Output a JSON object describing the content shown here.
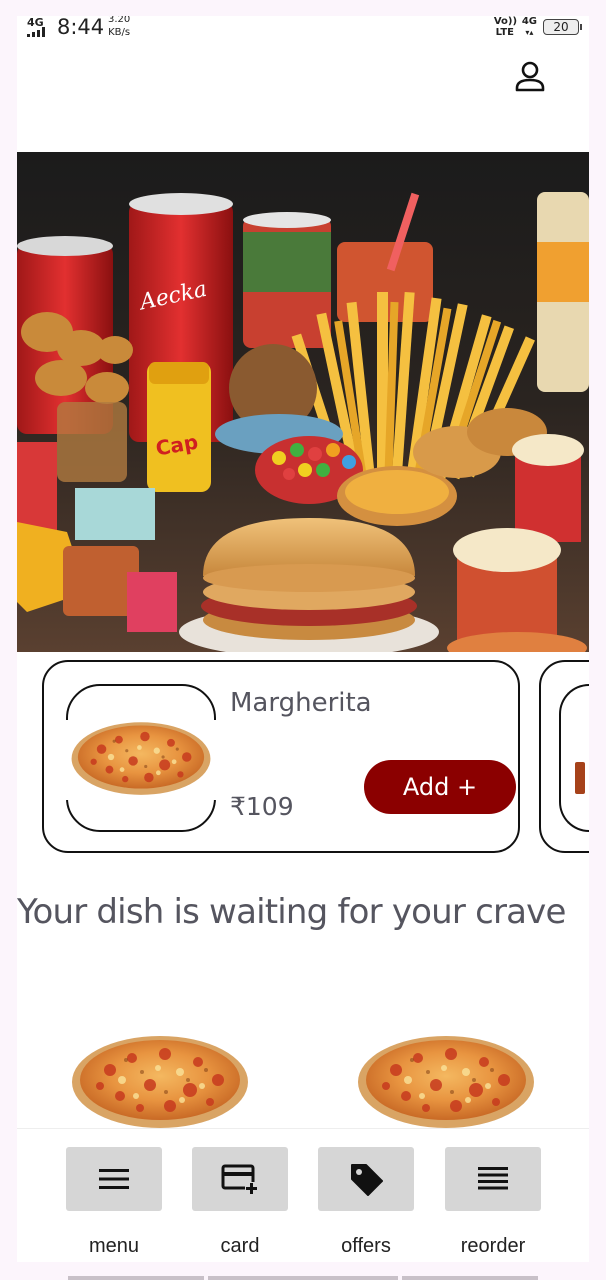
{
  "status_bar": {
    "network": "4G",
    "time": "8:44",
    "speed_value": "3.20",
    "speed_unit": "KB/s",
    "volte": "Vo)) LTE",
    "data_type": "4G",
    "battery": "20"
  },
  "header": {
    "profile_icon": "person-icon"
  },
  "hero": {
    "image": "fast-food-spread"
  },
  "featured": {
    "name": "Margherita",
    "price": "₹109",
    "add_label": "Add  +",
    "accent": "#8b0000"
  },
  "main": {
    "heading": "Your dish is waiting for your crave"
  },
  "nav": {
    "items": [
      {
        "label": "menu",
        "icon": "menu-icon"
      },
      {
        "label": "card",
        "icon": "credit-card-icon"
      },
      {
        "label": "offers",
        "icon": "tag-icon"
      },
      {
        "label": "reorder",
        "icon": "reorder-icon"
      }
    ]
  }
}
